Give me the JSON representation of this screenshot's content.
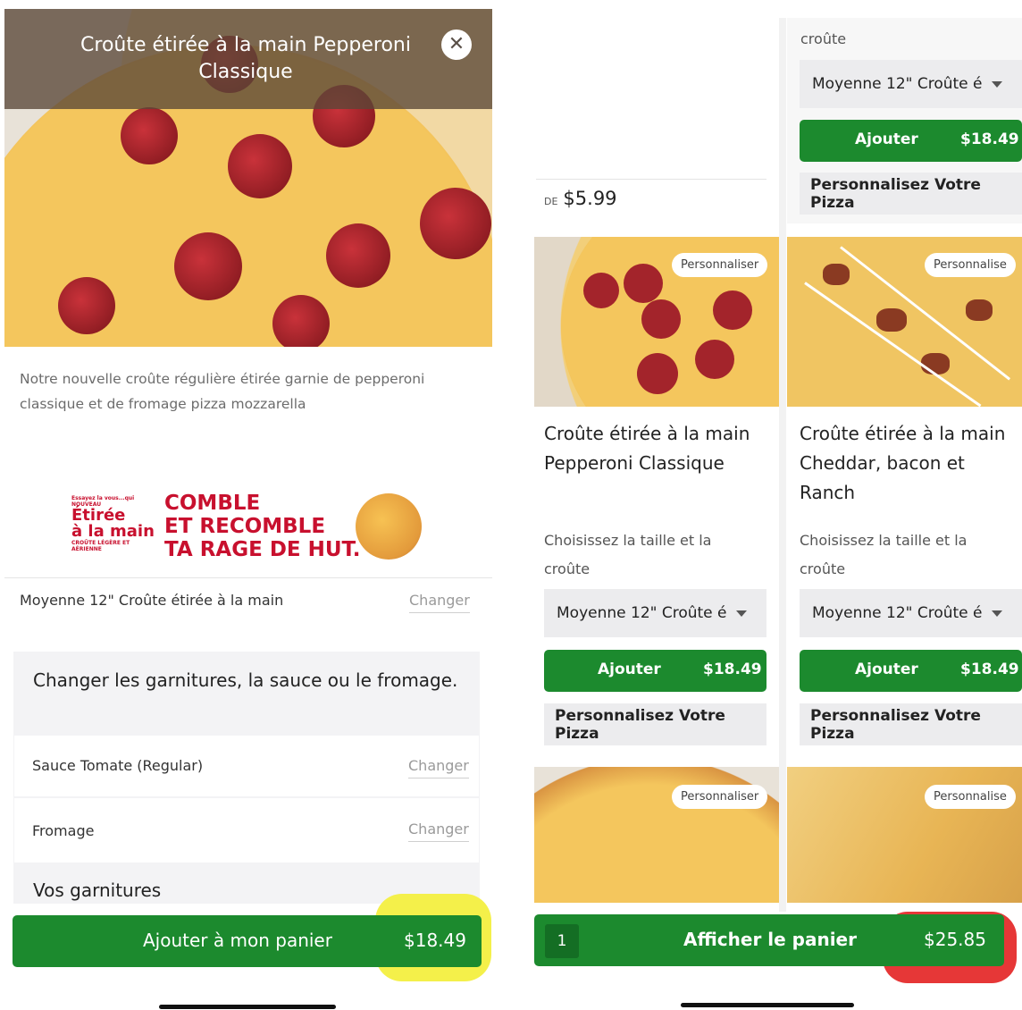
{
  "left": {
    "hero_title": "Croûte étirée à la main Pepperoni Classique",
    "description": "Notre nouvelle croûte régulière étirée garnie de pepperoni classique et de fromage pizza mozzarella",
    "banner": {
      "small_top": "Essayez la vous...qui",
      "small_new": "NOUVEAU",
      "etiree": "Étirée",
      "alamain": "à la main",
      "small_bottom": "CROÛTE LÉGÈRE ET AÉRIENNE",
      "line1": "COMBLE",
      "line2": "ET RECOMBLE",
      "line3": "TA RAGE DE HUT."
    },
    "size_label": "Moyenne 12\" Croûte étirée à la main",
    "changer_label": "Changer",
    "toppings_heading": "Changer les garnitures, la sauce ou le fromage.",
    "sauce_label": "Sauce Tomate (Regular)",
    "cheese_label": "Fromage",
    "your_toppings": "Vos garnitures",
    "cta_label": "Ajouter à mon panier",
    "cta_price": "$18.49"
  },
  "right": {
    "top_partial": "croûte",
    "price_from_prefix": "DE",
    "price_from": "$5.99",
    "select_value": "Moyenne 12\" Croûte é",
    "add_label": "Ajouter",
    "add_price": "$18.49",
    "customize_label": "Personnalisez Votre Pizza",
    "customize_pill": "Personnaliser",
    "customize_pill_partial": "Personnalise",
    "customize_partial": "Personnalisez Votre Pizza",
    "card1_title": "Croûte étirée à la main Pepperoni Classique",
    "card2_title": "Croûte étirée à la main Cheddar, bacon et Ranch",
    "choose_label": "Choisissez la taille et la croûte",
    "cta_qty": "1",
    "cta_label": "Afficher le panier",
    "cta_price": "$25.85"
  },
  "colors": {
    "green": "#1c8a2e",
    "highlight_yellow": "#f4f04a",
    "highlight_red": "#e63737"
  }
}
